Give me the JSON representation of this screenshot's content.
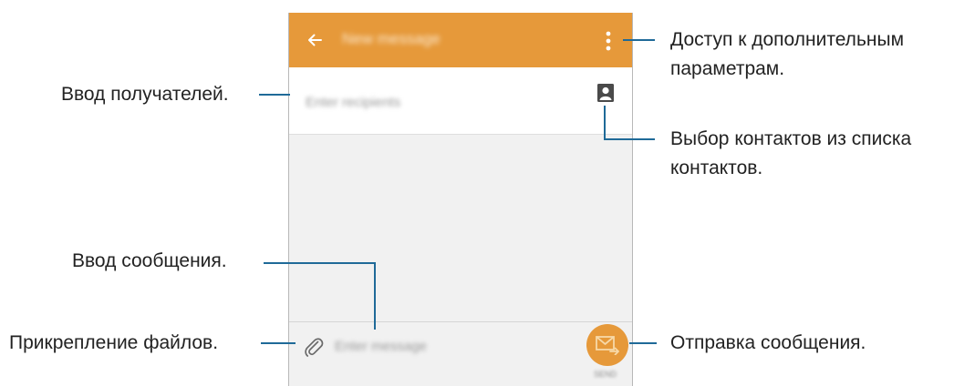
{
  "screen": {
    "appbar": {
      "title": "New message",
      "back_icon": "arrow-left-icon",
      "more_icon": "more-vertical-icon"
    },
    "recipient": {
      "placeholder": "Enter recipients",
      "contacts_icon": "contact-card-icon"
    },
    "compose": {
      "placeholder": "Enter message",
      "attach_icon": "paperclip-icon",
      "send_icon": "envelope-send-icon",
      "send_caption": "SEND"
    },
    "colors": {
      "accent": "#e6993a",
      "callout_line": "#1f6a98",
      "background": "#f1f1f1"
    }
  },
  "callouts": {
    "recipients": "Ввод получателей.",
    "more_options_line1": "Доступ к дополнительным",
    "more_options_line2": "параметрам.",
    "contacts_line1": "Выбор контактов из списка",
    "contacts_line2": "контактов.",
    "message": "Ввод сообщения.",
    "attach": "Прикрепление файлов.",
    "send": "Отправка сообщения."
  }
}
